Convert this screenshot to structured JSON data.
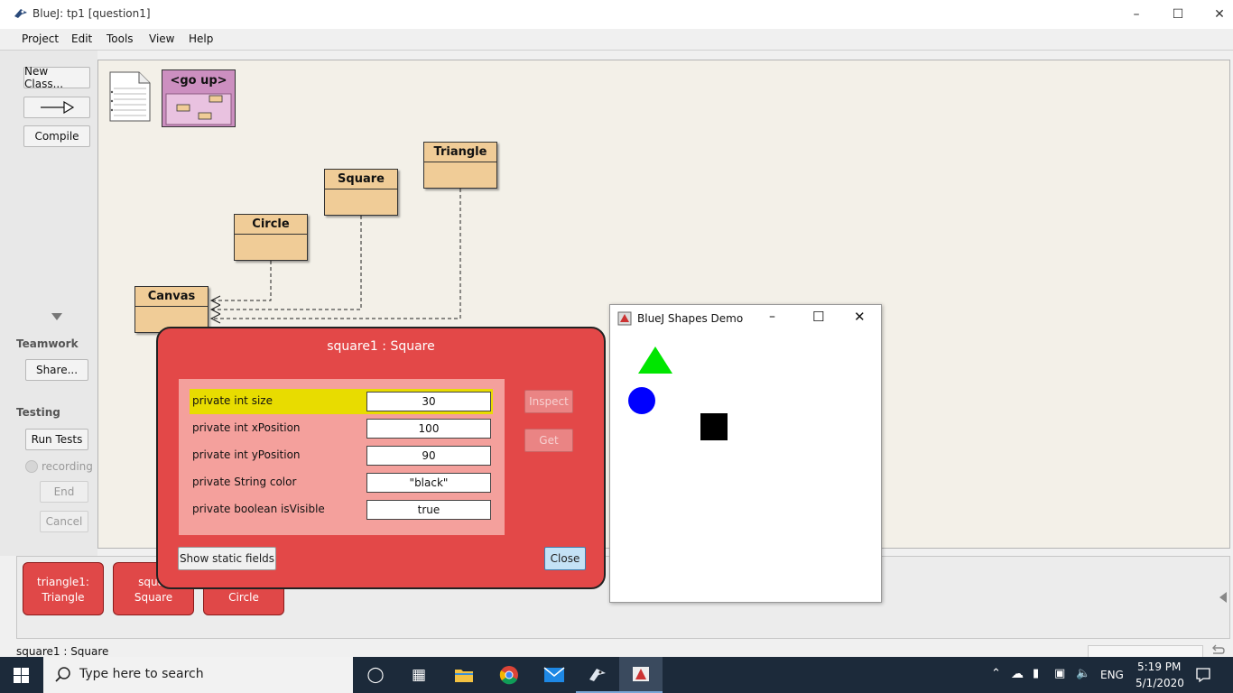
{
  "window": {
    "title": "BlueJ:  tp1  [question1]"
  },
  "menu": [
    "Project",
    "Edit",
    "Tools",
    "View",
    "Help"
  ],
  "left_panel": {
    "new_class": "New Class...",
    "compile": "Compile",
    "teamwork_label": "Teamwork",
    "share": "Share...",
    "testing_label": "Testing",
    "run_tests": "Run Tests",
    "recording": "recording",
    "end": "End",
    "cancel": "Cancel"
  },
  "diagram": {
    "go_up": "<go up>",
    "classes": {
      "triangle": "Triangle",
      "square": "Square",
      "circle": "Circle",
      "canvas": "Canvas"
    }
  },
  "bench": {
    "objects": [
      {
        "line1": "triangle1:",
        "line2": "Triangle"
      },
      {
        "line1": "squar",
        "line2": "Square"
      },
      {
        "line1": "",
        "line2": "Circle"
      }
    ]
  },
  "status_bar": "square1 : Square",
  "inspector": {
    "title": "square1 : Square",
    "fields": [
      {
        "label": "private int size",
        "value": "30",
        "highlighted": true
      },
      {
        "label": "private int xPosition",
        "value": "100"
      },
      {
        "label": "private int yPosition",
        "value": "90"
      },
      {
        "label": "private String color",
        "value": "\"black\""
      },
      {
        "label": "private boolean isVisible",
        "value": "true"
      }
    ],
    "inspect": "Inspect",
    "get": "Get",
    "show_static": "Show static fields",
    "close": "Close"
  },
  "shapes_window": {
    "title": "BlueJ Shapes Demo",
    "shapes": {
      "triangle_color": "#00e600",
      "circle_color": "#0000ff",
      "square_color": "#000000"
    }
  },
  "taskbar": {
    "search_placeholder": "Type here to search",
    "lang": "ENG",
    "time": "5:19 PM",
    "date": "5/1/2020"
  }
}
